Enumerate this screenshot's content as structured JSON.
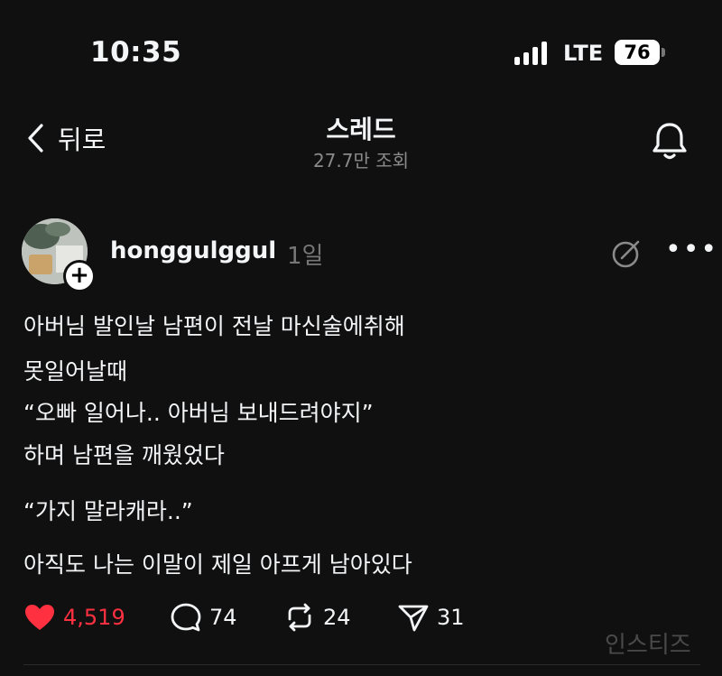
{
  "status_bar": {
    "time": "10:35",
    "network": "LTE",
    "battery": "76"
  },
  "nav": {
    "back_label": "뒤로",
    "title": "스레드",
    "views": "27.7만 조회"
  },
  "post": {
    "username": "honggulggul",
    "age": "1일",
    "lines": [
      "아버님 발인날 남편이 전날 마신술에취해",
      "못일어날때",
      "“오빠 일어나.. 아버님 보내드려야지”",
      "하며 남편을 깨웠었다",
      "“가지 말라캐라..”",
      "아직도 나는 이말이 제일 아프게 남아있다"
    ],
    "actions": {
      "likes": "4,519",
      "comments": "74",
      "reposts": "24",
      "shares": "31"
    }
  },
  "watermark": "인스티즈",
  "colors": {
    "background": "#101010",
    "like": "#ff3040",
    "muted": "#8a8a8a"
  },
  "icons": [
    "chevron-left-icon",
    "bell-icon",
    "plus-icon",
    "edit-circle-icon",
    "more-icon",
    "heart-icon",
    "comment-icon",
    "repost-icon",
    "send-icon"
  ]
}
